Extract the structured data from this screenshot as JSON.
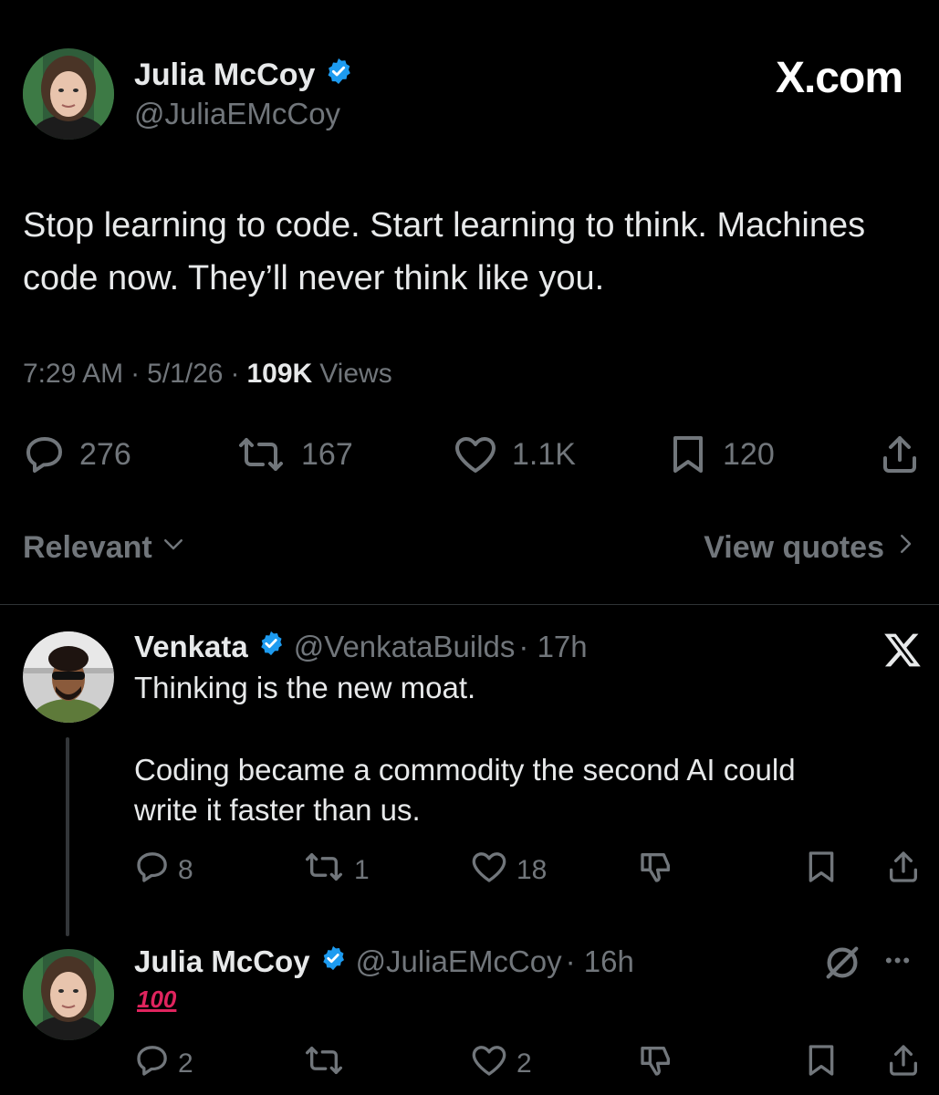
{
  "main_tweet": {
    "author_name": "Julia McCoy",
    "handle": "@JuliaEMcCoy",
    "watermark": "X.com",
    "text_line1": "Stop learning to code. Start learning to think. Machines",
    "text_line2": "code now. They’ll never think like you.",
    "time": "7:29 AM",
    "sep1": "·",
    "date": "5/1/26",
    "sep2": "·",
    "views_count": "109K",
    "views_label": "Views",
    "stats": {
      "replies": "276",
      "reposts": "167",
      "likes": "1.1K",
      "bookmarks": "120"
    }
  },
  "sort": {
    "label": "Relevant",
    "view_quotes": "View quotes"
  },
  "replies": [
    {
      "author_name": "Venkata",
      "handle": "@VenkataBuilds",
      "time": "· 17h",
      "line1": "Thinking is the new moat.",
      "line2": "Coding became a commodity the second AI could",
      "line3": "write it faster than us.",
      "stats": {
        "replies": "8",
        "reposts": "1",
        "likes": "18"
      }
    },
    {
      "author_name": "Julia McCoy",
      "handle": "@JuliaEMcCoy",
      "time": "· 16h",
      "emoji": "100",
      "more": "•••",
      "stats": {
        "replies": "2",
        "likes": "2"
      }
    }
  ],
  "colors": {
    "background": "#000000",
    "text": "#e7e9ea",
    "muted": "#71767b",
    "verified": "#1d9bf0",
    "emoji_red": "#e0245e"
  }
}
